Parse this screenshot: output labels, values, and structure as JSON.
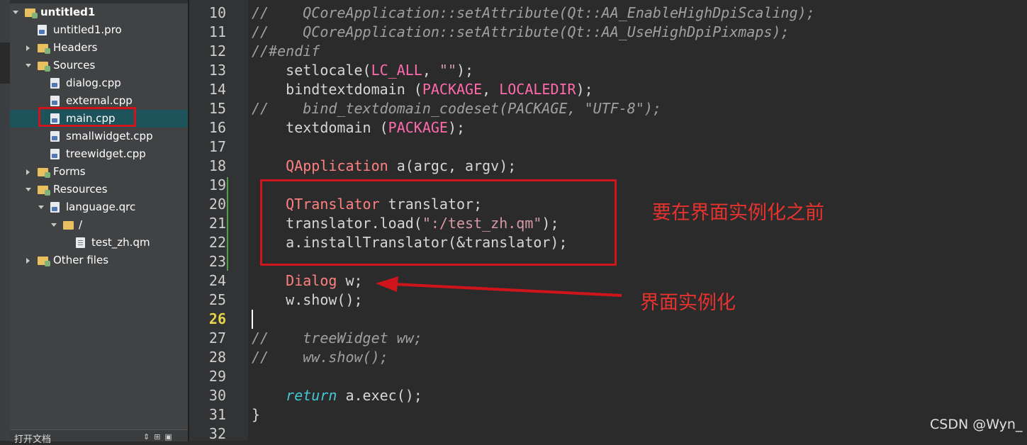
{
  "project_tree": {
    "items": [
      {
        "label": "untitled1",
        "depth": 0,
        "expand": "down",
        "icon": "project-folder-icon",
        "bold": true
      },
      {
        "label": "untitled1.pro",
        "depth": 1,
        "expand": "none",
        "icon": "pro-file-icon"
      },
      {
        "label": "Headers",
        "depth": 1,
        "expand": "right",
        "icon": "headers-folder-icon"
      },
      {
        "label": "Sources",
        "depth": 1,
        "expand": "down",
        "icon": "sources-folder-icon"
      },
      {
        "label": "dialog.cpp",
        "depth": 2,
        "expand": "none",
        "icon": "cpp-file-icon"
      },
      {
        "label": "external.cpp",
        "depth": 2,
        "expand": "none",
        "icon": "cpp-file-icon"
      },
      {
        "label": "main.cpp",
        "depth": 2,
        "expand": "none",
        "icon": "cpp-file-icon",
        "selected": true
      },
      {
        "label": "smallwidget.cpp",
        "depth": 2,
        "expand": "none",
        "icon": "cpp-file-icon"
      },
      {
        "label": "treewidget.cpp",
        "depth": 2,
        "expand": "none",
        "icon": "cpp-file-icon"
      },
      {
        "label": "Forms",
        "depth": 1,
        "expand": "right",
        "icon": "forms-folder-icon"
      },
      {
        "label": "Resources",
        "depth": 1,
        "expand": "down",
        "icon": "resources-folder-icon"
      },
      {
        "label": "language.qrc",
        "depth": 2,
        "expand": "down",
        "icon": "qrc-file-icon"
      },
      {
        "label": "/",
        "depth": 3,
        "expand": "down",
        "icon": "folder-icon"
      },
      {
        "label": "test_zh.qm",
        "depth": 4,
        "expand": "none",
        "icon": "qm-file-icon"
      },
      {
        "label": "Other files",
        "depth": 1,
        "expand": "right",
        "icon": "other-files-folder-icon"
      }
    ]
  },
  "bottom_panel": {
    "label": "打开文档"
  },
  "editor": {
    "current_line": 26,
    "lines": [
      {
        "n": 10,
        "segments": [
          [
            "cmt",
            "//    QCoreApplication::setAttribute(Qt::AA_EnableHighDpiScaling);"
          ]
        ]
      },
      {
        "n": 11,
        "segments": [
          [
            "cmt",
            "//    QCoreApplication::setAttribute(Qt::AA_UseHighDpiPixmaps);"
          ]
        ]
      },
      {
        "n": 12,
        "segments": [
          [
            "cmt",
            "//#endif"
          ]
        ]
      },
      {
        "n": 13,
        "segments": [
          [
            "",
            "    setlocale("
          ],
          [
            "mac",
            "LC_ALL"
          ],
          [
            "",
            ", "
          ],
          [
            "str",
            "\"\""
          ],
          [
            "",
            ");"
          ]
        ]
      },
      {
        "n": 14,
        "segments": [
          [
            "",
            "    bindtextdomain ("
          ],
          [
            "mac",
            "PACKAGE"
          ],
          [
            "",
            ", "
          ],
          [
            "mac",
            "LOCALEDIR"
          ],
          [
            "",
            ");"
          ]
        ]
      },
      {
        "n": 15,
        "segments": [
          [
            "cmt",
            "//    bind_textdomain_codeset(PACKAGE, \"UTF-8\");"
          ]
        ]
      },
      {
        "n": 16,
        "segments": [
          [
            "",
            "    textdomain ("
          ],
          [
            "mac",
            "PACKAGE"
          ],
          [
            "",
            ");"
          ]
        ]
      },
      {
        "n": 17,
        "segments": []
      },
      {
        "n": 18,
        "segments": [
          [
            "",
            "    "
          ],
          [
            "typ",
            "QApplication"
          ],
          [
            "",
            " a(argc, argv);"
          ]
        ]
      },
      {
        "n": 19,
        "segments": []
      },
      {
        "n": 20,
        "segments": [
          [
            "",
            "    "
          ],
          [
            "typ",
            "QTranslator"
          ],
          [
            "",
            " translator;"
          ]
        ]
      },
      {
        "n": 21,
        "segments": [
          [
            "",
            "    translator.load("
          ],
          [
            "str",
            "\":/test_zh.qm\""
          ],
          [
            "",
            ");"
          ]
        ]
      },
      {
        "n": 22,
        "segments": [
          [
            "",
            "    a.installTranslator(&translator);"
          ]
        ]
      },
      {
        "n": 23,
        "segments": []
      },
      {
        "n": 24,
        "segments": [
          [
            "",
            "    "
          ],
          [
            "typ",
            "Dialog"
          ],
          [
            "",
            " w;"
          ]
        ]
      },
      {
        "n": 25,
        "segments": [
          [
            "",
            "    w.show();"
          ]
        ]
      },
      {
        "n": 26,
        "segments": []
      },
      {
        "n": 27,
        "segments": [
          [
            "cmt",
            "//    treeWidget ww;"
          ]
        ]
      },
      {
        "n": 28,
        "segments": [
          [
            "cmt",
            "//    ww.show();"
          ]
        ]
      },
      {
        "n": 29,
        "segments": []
      },
      {
        "n": 30,
        "segments": [
          [
            "",
            "    "
          ],
          [
            "kw",
            "return"
          ],
          [
            "",
            " a.exec();"
          ]
        ]
      },
      {
        "n": 31,
        "segments": [
          [
            "",
            "}"
          ]
        ]
      },
      {
        "n": 32,
        "segments": []
      }
    ]
  },
  "annotations": {
    "before_ui_instantiation": "要在界面实例化之前",
    "ui_instantiation": "界面实例化"
  },
  "watermark": "CSDN @Wyn_",
  "colors": {
    "highlight_red": "#d0141b",
    "annotation_red": "#e8322e",
    "selection": "#1d545c"
  }
}
